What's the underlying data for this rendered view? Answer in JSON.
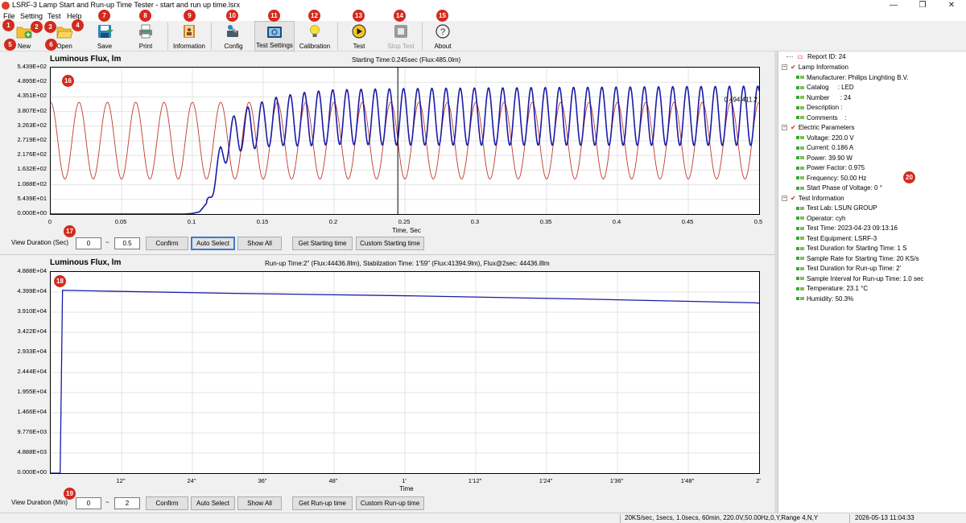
{
  "window": {
    "title": "LSRF-3 Lamp Start and Run-up Time Tester - start and run up time.lsrx",
    "controls": [
      "—",
      "❐",
      "✕"
    ]
  },
  "menu": [
    "File",
    "Setting",
    "Test",
    "Help"
  ],
  "toolbar": [
    {
      "label": "New",
      "icon": "new-file-icon"
    },
    {
      "label": "Open",
      "icon": "open-folder-icon"
    },
    {
      "label": "Save",
      "icon": "save-icon"
    },
    {
      "label": "Print",
      "icon": "printer-icon"
    },
    {
      "label": "Information",
      "icon": "information-book-icon"
    },
    {
      "label": "Config",
      "icon": "config-wrench-icon"
    },
    {
      "label": "Test Settings",
      "icon": "test-settings-icon"
    },
    {
      "label": "Calibration",
      "icon": "lightbulb-icon"
    },
    {
      "label": "Test",
      "icon": "play-icon"
    },
    {
      "label": "Stop Test",
      "icon": "stop-icon",
      "disabled": true
    },
    {
      "label": "About",
      "icon": "help-icon"
    }
  ],
  "badges": [
    "1",
    "2",
    "3",
    "4",
    "5",
    "6",
    "7",
    "8",
    "9",
    "10",
    "11",
    "12",
    "13",
    "14",
    "15",
    "16",
    "17",
    "18",
    "19",
    "20"
  ],
  "chart_data": [
    {
      "type": "line",
      "title": "Luminous Flux, lm",
      "subtitle": "Starting Time:0.245sec (Flux:485.0lm)",
      "xlabel": "Time, Sec",
      "ylabel": "",
      "xlim": [
        0,
        0.5
      ],
      "ylim": [
        0,
        543.9
      ],
      "x_ticks": [
        "0",
        "0.05",
        "0.1",
        "0.15",
        "0.2",
        "0.25",
        "0.3",
        "0.35",
        "0.4",
        "0.45",
        "0.5"
      ],
      "y_ticks": [
        "0.000E+00",
        "5.439E+01",
        "1.088E+02",
        "1.632E+02",
        "2.176E+02",
        "2.719E+02",
        "3.263E+02",
        "3.807E+02",
        "4.351E+02",
        "4.895E+02",
        "5.439E+02"
      ],
      "grid": true,
      "cursor_x": 0.245,
      "cursor_label": "0.494,411.2",
      "series": [
        {
          "color": "#c0392b",
          "description": "voltage reference sine",
          "frequency_hz": 50,
          "min": 130,
          "max": 415
        },
        {
          "color": "#1a1aa8",
          "description": "luminous flux",
          "points": [
            [
              0,
              0
            ],
            [
              0.095,
              0
            ],
            [
              0.1,
              2
            ],
            [
              0.105,
              8
            ],
            [
              0.11,
              40
            ],
            [
              0.115,
              110
            ],
            [
              0.12,
              200
            ],
            [
              0.125,
              270
            ],
            [
              0.13,
              300
            ],
            [
              0.14,
              320
            ],
            [
              0.16,
              345
            ],
            [
              0.2,
              360
            ],
            [
              0.3,
              362
            ],
            [
              0.5,
              365
            ]
          ],
          "ripple_amplitude": [
            [
              0.11,
              10
            ],
            [
              0.12,
              60
            ],
            [
              0.14,
              80
            ],
            [
              0.18,
              100
            ],
            [
              0.25,
              105
            ],
            [
              0.5,
              110
            ]
          ],
          "frequency_hz": 100
        }
      ]
    },
    {
      "type": "line",
      "title": "Luminous Flux, lm",
      "subtitle": "Run-up Time:2\" (Flux:44436.8lm), Stabilzation Time: 1'59\" (Flux:41394.9lm), Flux@2sec: 44436.8lm",
      "xlabel": "Time",
      "ylabel": "",
      "xlim": [
        0,
        120
      ],
      "ylim": [
        0,
        48880
      ],
      "x_ticks": [
        "12\"",
        "24\"",
        "36\"",
        "48\"",
        "1'",
        "1'12\"",
        "1'24\"",
        "1'36\"",
        "1'48\"",
        "2'"
      ],
      "y_ticks": [
        "0.000E+00",
        "4.888E+03",
        "9.776E+03",
        "1.466E+04",
        "1.955E+04",
        "2.444E+04",
        "2.933E+04",
        "3.422E+04",
        "3.910E+04",
        "4.399E+04",
        "4.888E+04"
      ],
      "grid": true,
      "series": [
        {
          "color": "#1a1aa8",
          "description": "luminous flux",
          "points": [
            [
              0,
              0
            ],
            [
              1.6,
              0
            ],
            [
              2,
              44436.8
            ],
            [
              10,
              44200
            ],
            [
              30,
              43700
            ],
            [
              60,
              43100
            ],
            [
              90,
              42300
            ],
            [
              119,
              41394.9
            ],
            [
              120,
              41300
            ]
          ]
        }
      ]
    }
  ],
  "controls_top": {
    "label": "View Duration (Sec)",
    "from": "0",
    "sep": "~",
    "to": "0.5",
    "buttons": [
      "Confirm",
      "Auto Select",
      "Show All",
      "Get Starting time",
      "Custom Starting time"
    ]
  },
  "controls_bottom": {
    "label": "View Duration (Min)",
    "from": "0",
    "sep": "~",
    "to": "2",
    "buttons": [
      "Confirm",
      "Auto Select",
      "Show All",
      "Get Run-up time",
      "Custom Run-up time"
    ]
  },
  "tree": {
    "report": "Report ID: 24",
    "groups": [
      {
        "title": "Lamp Information",
        "items": [
          "Manufacturer: Philips Linghting B.V.",
          "Catalog     : LED",
          "Number      : 24",
          "Description :",
          "Comments    :"
        ]
      },
      {
        "title": "Electric Parameters",
        "items": [
          "Voltage: 220.0 V",
          "Current: 0.186 A",
          "Power: 39.90 W",
          "Power Factor: 0.975",
          "Frequency: 50.00 Hz",
          "Start Phase of Voltage: 0 °"
        ]
      },
      {
        "title": "Test Information",
        "items": [
          "Test Lab: LSUN GROUP",
          "Operator: cyh",
          "Test Time: 2023-04-23 09:13:16",
          "Test Equipment: LSRF-3",
          "Test Duration for Starting Time: 1 S",
          "Sample Rate for Starting Time: 20 KS/s",
          "Test Duration for Run-up Time: 2'",
          "Sample Interval for Run-up Time: 1.0 sec",
          "Temperature: 23.1 °C",
          "Humidity: 50.3%"
        ]
      }
    ]
  },
  "status": {
    "info": "20KS/sec, 1secs, 1.0secs,  60min,  220.0V,50.00Hz,0,Y,Range 4,N,Y",
    "datetime": "2026-05-13 11:04:33"
  }
}
